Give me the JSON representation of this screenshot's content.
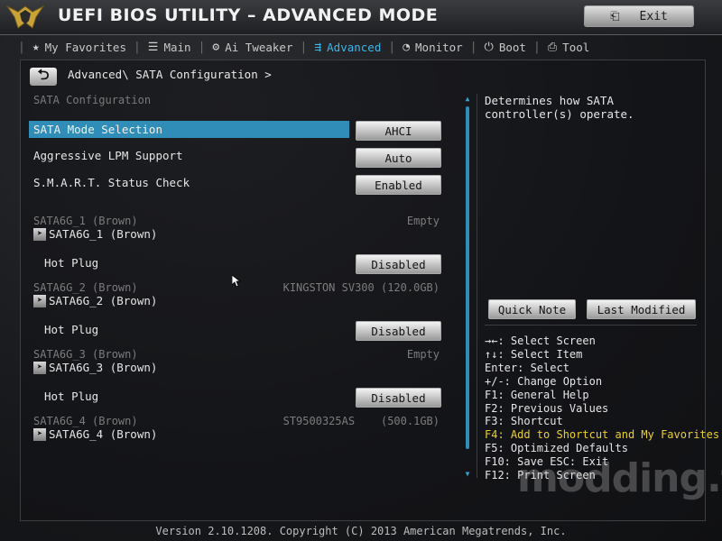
{
  "header": {
    "title": "UEFI BIOS UTILITY – ADVANCED MODE",
    "exit_label": "Exit"
  },
  "tabs": [
    {
      "label": "My Favorites",
      "icon": "star-icon",
      "active": false
    },
    {
      "label": "Main",
      "icon": "list-icon",
      "active": false
    },
    {
      "label": "Ai Tweaker",
      "icon": "ai-tweaker-icon",
      "active": false
    },
    {
      "label": "Advanced",
      "icon": "advanced-icon",
      "active": true
    },
    {
      "label": "Monitor",
      "icon": "monitor-icon",
      "active": false
    },
    {
      "label": "Boot",
      "icon": "power-icon",
      "active": false
    },
    {
      "label": "Tool",
      "icon": "tool-icon",
      "active": false
    }
  ],
  "breadcrumb": "Advanced\\ SATA Configuration >",
  "section_title": "SATA Configuration",
  "settings": [
    {
      "label": "SATA Mode Selection",
      "value": "AHCI"
    },
    {
      "label": "Aggressive LPM Support",
      "value": "Auto"
    },
    {
      "label": "S.M.A.R.T. Status Check",
      "value": "Enabled"
    }
  ],
  "ports": [
    {
      "label": "SATA6G_1 (Brown)",
      "device": "Empty",
      "sub_label": "SATA6G_1 (Brown)",
      "hotplug_label": "Hot Plug",
      "hotplug_value": "Disabled"
    },
    {
      "label": "SATA6G_2 (Brown)",
      "device": "KINGSTON SV300 (120.0GB)",
      "sub_label": "SATA6G_2 (Brown)",
      "hotplug_label": "Hot Plug",
      "hotplug_value": "Disabled"
    },
    {
      "label": "SATA6G_3 (Brown)",
      "device": "Empty",
      "sub_label": "SATA6G_3 (Brown)",
      "hotplug_label": "Hot Plug",
      "hotplug_value": "Disabled"
    },
    {
      "label": "SATA6G_4 (Brown)",
      "device": "ST9500325AS    (500.1GB)",
      "sub_label": "SATA6G_4 (Brown)"
    }
  ],
  "help_text": "Determines how SATA controller(s) operate.",
  "quick_note_label": "Quick Note",
  "last_modified_label": "Last Modified",
  "keys": [
    "→←: Select Screen",
    "↑↓: Select Item",
    "Enter: Select",
    "+/-: Change Option",
    "F1: General Help",
    "F2: Previous Values",
    "F3: Shortcut",
    "F4: Add to Shortcut and My Favorites",
    "F5: Optimized Defaults",
    "F10: Save  ESC: Exit",
    "F12: Print Screen"
  ],
  "watermark": "modding.fr",
  "footer": "Version 2.10.1208. Copyright (C) 2013 American Megatrends, Inc.",
  "colors": {
    "accent": "#2f8db7",
    "active_tab": "#3cb4e6",
    "highlight_key": "#e8d02e"
  }
}
